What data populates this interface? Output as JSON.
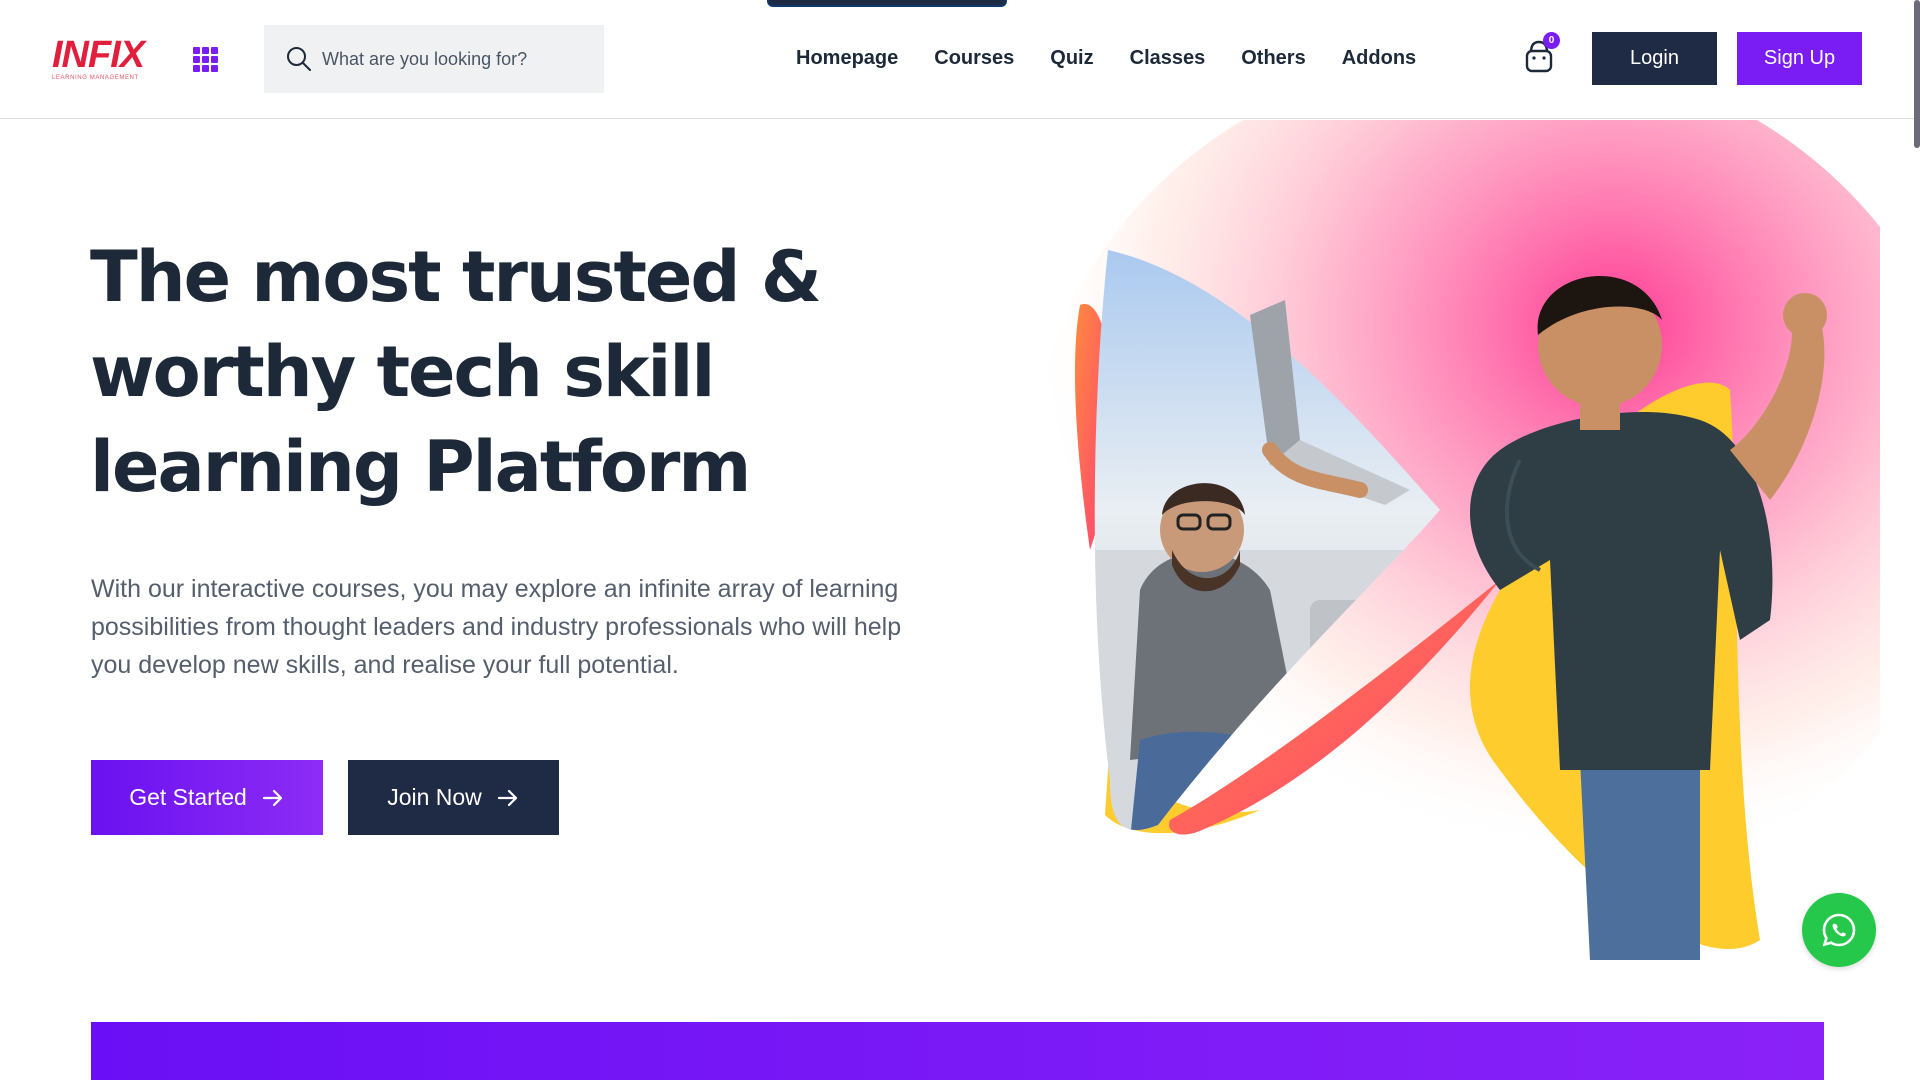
{
  "brand": {
    "name": "INFIX",
    "tagline": "LEARNING MANAGEMENT"
  },
  "search": {
    "placeholder": "What are you looking for?"
  },
  "nav": {
    "items": [
      {
        "label": "Homepage"
      },
      {
        "label": "Courses"
      },
      {
        "label": "Quiz"
      },
      {
        "label": "Classes"
      },
      {
        "label": "Others"
      },
      {
        "label": "Addons"
      }
    ]
  },
  "cart": {
    "count": "0"
  },
  "auth": {
    "login_label": "Login",
    "signup_label": "Sign Up"
  },
  "hero": {
    "title": "The most trusted & worthy tech skill learning Platform",
    "description": "With our interactive courses, you may explore an infinite array of learning possibilities from thought leaders and industry professionals who will help you develop new skills, and realise your full potential.",
    "primary_button": "Get Started",
    "secondary_button": "Join Now"
  },
  "colors": {
    "primary": "#7a1cf4",
    "dark": "#1f2a44",
    "text": "#1d2939",
    "logo_red": "#e01f3d",
    "whatsapp_green": "#25c84a"
  },
  "icons": [
    "grid-icon",
    "search-icon",
    "cart-icon",
    "arrow-right-icon",
    "whatsapp-icon"
  ]
}
